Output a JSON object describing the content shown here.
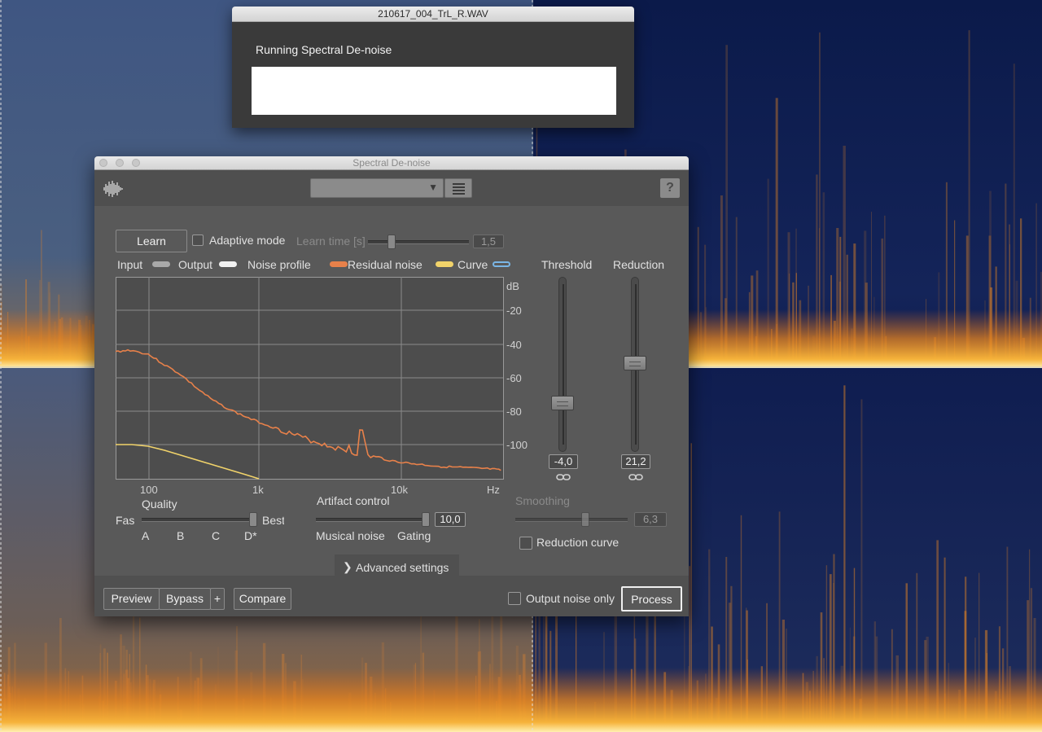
{
  "progress_window": {
    "title": "210617_004_TrL_R.WAV",
    "message": "Running Spectral De-noise"
  },
  "plugin_window": {
    "title": "Spectral De-noise",
    "header": {
      "logo_icon": "waveform-logo-icon",
      "preset_value": "",
      "preset_menu_icon": "list-menu-icon",
      "help_label": "?"
    },
    "learn_row": {
      "learn_label": "Learn",
      "adaptive_mode_label": "Adaptive mode",
      "adaptive_mode_checked": false,
      "learn_time_label": "Learn time [s]",
      "learn_time_value": "1,5"
    },
    "legend": [
      {
        "label": "Input",
        "color": "#a9a9a9"
      },
      {
        "label": "Output",
        "color": "#f2f2f2"
      },
      {
        "label": "Noise profile",
        "color": "#e8814a"
      },
      {
        "label": "Residual noise",
        "color": "#f1d36a"
      },
      {
        "label": "Curve",
        "color": "#7ab6e6"
      }
    ],
    "graph": {
      "y_unit": "dB",
      "y_ticks": [
        "-20",
        "-40",
        "-60",
        "-80",
        "-100"
      ],
      "x_ticks": [
        "100",
        "1k",
        "10k",
        "Hz"
      ]
    },
    "threshold": {
      "label": "Threshold",
      "value": "-4,0",
      "level": 0.76,
      "link_icon": "link-icon"
    },
    "reduction": {
      "label": "Reduction",
      "value": "21,2",
      "level": 0.49,
      "link_icon": "link-icon"
    },
    "quality": {
      "label": "Quality",
      "left": "Fas",
      "right": "Best",
      "marks": [
        "A",
        "B",
        "C",
        "D*"
      ],
      "level": 1.0
    },
    "artifact_control": {
      "label": "Artifact control",
      "value": "10,0",
      "left": "Musical noise",
      "right": "Gating",
      "level": 1.0
    },
    "smoothing": {
      "label": "Smoothing",
      "value": "6,3",
      "level": 0.63
    },
    "reduction_curve": {
      "label": "Reduction curve",
      "checked": false
    },
    "advanced_settings_label": "Advanced settings",
    "footer": {
      "preview_label": "Preview",
      "bypass_label": "Bypass",
      "plus_label": "+",
      "compare_label": "Compare",
      "output_noise_only_label": "Output noise only",
      "output_noise_only_checked": false,
      "process_label": "Process"
    }
  },
  "colors": {
    "spectrogram_bg_left": "#3b4f7a",
    "spectrogram_bg_right": "#0b1a4a",
    "spectrogram_hot": "#f2a23a",
    "noise_profile": "#e8814a",
    "residual_noise": "#f1d36a"
  }
}
